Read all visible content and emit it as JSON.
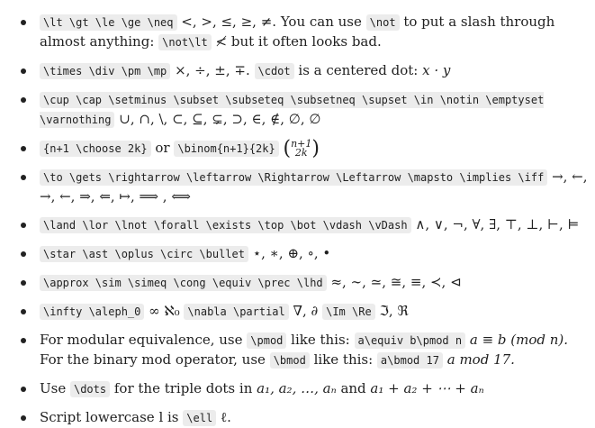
{
  "items": [
    {
      "code1": "\\lt \\gt \\le \\ge \\neq",
      "math1": "<, >, ≤, ≥, ≠.",
      "text1": " You can use ",
      "code2": "\\not",
      "text2": " to put a slash through almost anything: ",
      "code3": "\\not\\lt",
      "math2": "≮",
      "text3": " but it often looks bad."
    },
    {
      "code1": "\\times \\div \\pm \\mp",
      "math1": "×, ÷, ±, ∓.",
      "code2": "\\cdot",
      "text1": " is a centered dot: ",
      "math2": "x · y"
    },
    {
      "code1": "\\cup \\cap \\setminus \\subset \\subseteq \\subsetneq \\supset \\in \\notin \\emptyset \\varnothing",
      "math1": "∪, ∩, \\, ⊂, ⊆, ⊊, ⊃, ∈, ∉, ∅, ∅"
    },
    {
      "code1": "{n+1 \\choose 2k}",
      "text1": " or ",
      "code2": "\\binom{n+1}{2k}",
      "math_top": "n+1",
      "math_bottom": "2k"
    },
    {
      "code1": "\\to \\gets \\rightarrow \\leftarrow \\Rightarrow \\Leftarrow \\mapsto \\implies \\iff",
      "math1": "→, ←, →, ←, ⇒, ⇐, ↦, ⟹ , ⟺"
    },
    {
      "code1": "\\land \\lor \\lnot \\forall \\exists \\top \\bot \\vdash \\vDash",
      "math1": "∧, ∨, ¬, ∀, ∃, ⊤, ⊥, ⊢, ⊨"
    },
    {
      "code1": "\\star \\ast \\oplus \\circ \\bullet",
      "math1": "⋆, ∗, ⊕, ∘, •"
    },
    {
      "code1": "\\approx \\sim \\simeq \\cong \\equiv \\prec \\lhd",
      "math1": "≈, ∼, ≃, ≅, ≡, ≺, ⊲"
    },
    {
      "code1": "\\infty \\aleph_0",
      "math1": "∞ ℵ₀",
      "code2": "\\nabla \\partial",
      "math2": "∇, ∂",
      "code3": "\\Im \\Re",
      "math3": "ℑ, ℜ"
    },
    {
      "text1": "For modular equivalence, use ",
      "code1": "\\pmod",
      "text2": " like this: ",
      "code2": "a\\equiv b\\pmod n",
      "math1": "a ≡ b (mod n).",
      "text3": " For the binary mod operator, use ",
      "code3": "\\bmod",
      "text4": " like this: ",
      "code4": "a\\bmod 17",
      "math2": "a mod 17."
    },
    {
      "text1": "Use ",
      "code1": "\\dots",
      "text2": " for the triple dots in ",
      "math1": "a₁, a₂, …, aₙ",
      "text3": " and ",
      "math2": "a₁ + a₂ + ⋯ + aₙ"
    },
    {
      "text1": "Script lowercase l is ",
      "code1": "\\ell",
      "math1": "ℓ."
    }
  ]
}
